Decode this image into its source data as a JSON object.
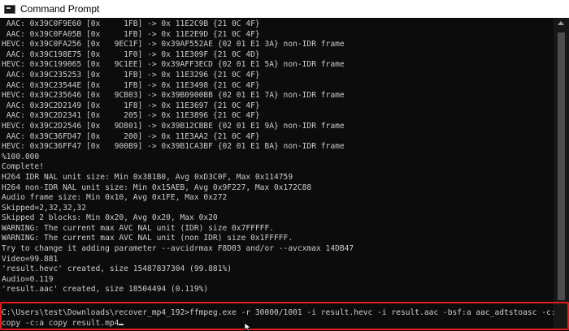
{
  "window": {
    "title": "Command Prompt",
    "icon": "cmd-icon"
  },
  "output_lines": [
    " AAC: 0x39C0F9E60 [0x     1FB] -> 0x 11E2C9B {21 0C 4F}",
    " AAC: 0x39C0FA05B [0x     1FB] -> 0x 11E2E9D {21 0C 4F}",
    "HEVC: 0x39C0FA256 [0x   9EC1F] -> 0x39AF552AE {02 01 E1 3A} non-IDR frame",
    " AAC: 0x39C198E75 [0x     1F0] -> 0x 11E309F {21 0C 4D}",
    "HEVC: 0x39C199065 [0x   9C1EE] -> 0x39AFF3ECD {02 01 E1 5A} non-IDR frame",
    " AAC: 0x39C235253 [0x     1FB] -> 0x 11E3296 {21 0C 4F}",
    " AAC: 0x39C23544E [0x     1FB] -> 0x 11E3498 {21 0C 4F}",
    "HEVC: 0x39C235646 [0x   9CB03] -> 0x39B0900BB {02 01 E1 7A} non-IDR frame",
    " AAC: 0x39C2D2149 [0x     1F8] -> 0x 11E3697 {21 0C 4F}",
    " AAC: 0x39C2D2341 [0x     205] -> 0x 11E3896 {21 0C 4F}",
    "HEVC: 0x39C2D2546 [0x   9D801] -> 0x39B12CBBE {02 01 E1 9A} non-IDR frame",
    " AAC: 0x39C36FD47 [0x     200] -> 0x 11E3AA2 {21 0C 4F}",
    "HEVC: 0x39C36FF47 [0x   900B9] -> 0x39B1CA3BF {02 01 E1 BA} non-IDR frame",
    "%100.000",
    "Complete!",
    "H264 IDR NAL unit size: Min 0x381B0, Avg 0xD3C0F, Max 0x114759",
    "H264 non-IDR NAL unit size: Min 0x15AEB, Avg 0x9F227, Max 0x172C88",
    "Audio frame size: Min 0x10, Avg 0x1FE, Max 0x272",
    "Skipped=2,32,32,32",
    "Skipped 2 blocks: Min 0x20, Avg 0x20, Max 0x20",
    "WARNING: The current max AVC NAL unit (IDR) size 0x7FFFFF.",
    "WARNING: The current max AVC NAL unit (non IDR) size 0x1FFFFF.",
    "Try to change it adding parameter --avcidrmax F8D03 and/or --avcxmax 14DB47",
    "Video=99.881",
    "'result.hevc' created, size 15487837304 (99.881%)",
    "Audio=0.119",
    "'result.aac' created, size 18504494 (0.119%)",
    ""
  ],
  "command": {
    "line1": "C:\\Users\\test\\Downloads\\recover_mp4_192>ffmpeg.exe -r 30000/1001 -i result.hevc -i result.aac -bsf:a aac_adtstoasc -c:v",
    "line2": "copy -c:a copy result.mp4"
  },
  "colors": {
    "console_bg": "#0c0c0c",
    "console_text": "#cccccc",
    "highlight": "#e21b1b",
    "titlebar_bg": "#ffffff"
  }
}
